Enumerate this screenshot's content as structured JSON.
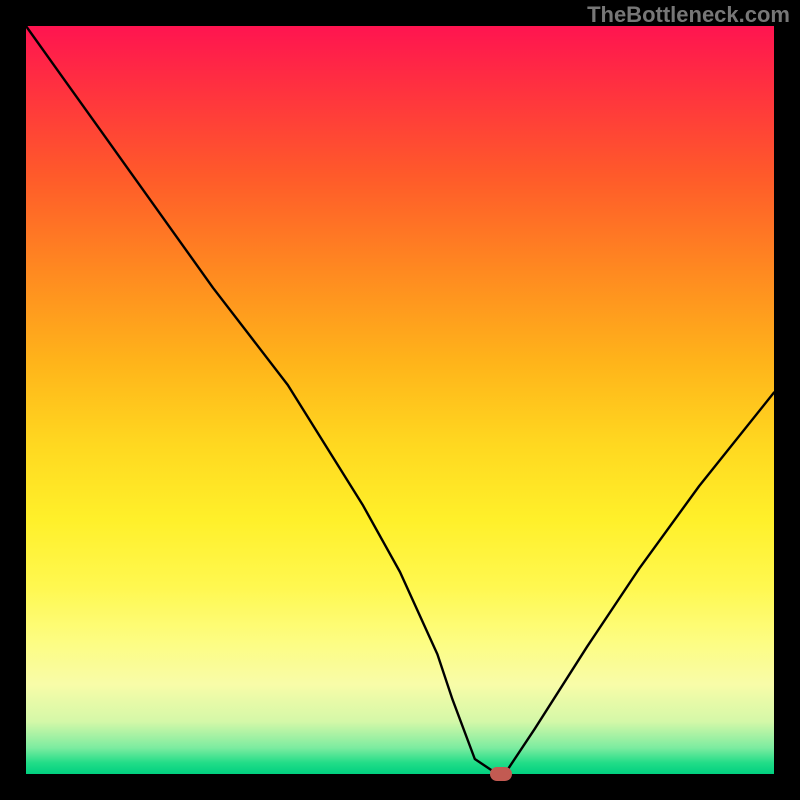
{
  "watermark": "TheBottleneck.com",
  "chart_data": {
    "type": "line",
    "title": "",
    "xlabel": "",
    "ylabel": "",
    "xlim": [
      0,
      1
    ],
    "ylim": [
      0,
      1
    ],
    "x": [
      0.0,
      0.05,
      0.1,
      0.15,
      0.2,
      0.25,
      0.3,
      0.35,
      0.4,
      0.45,
      0.5,
      0.55,
      0.57,
      0.6,
      0.63,
      0.64,
      0.68,
      0.75,
      0.82,
      0.9,
      1.0
    ],
    "values": [
      1.0,
      0.93,
      0.86,
      0.79,
      0.72,
      0.65,
      0.585,
      0.52,
      0.44,
      0.36,
      0.27,
      0.16,
      0.1,
      0.02,
      0.0,
      0.0,
      0.06,
      0.17,
      0.275,
      0.385,
      0.51
    ],
    "optimum_x": 0.635,
    "gradient_stops": [
      {
        "pos": 0.0,
        "color": "#ff1450"
      },
      {
        "pos": 0.3,
        "color": "#ff8a20"
      },
      {
        "pos": 0.66,
        "color": "#fff02a"
      },
      {
        "pos": 0.93,
        "color": "#d4f8a8"
      },
      {
        "pos": 1.0,
        "color": "#00d080"
      }
    ],
    "marker": {
      "x": 0.635,
      "y": 0.0,
      "color": "#c25a52"
    }
  }
}
